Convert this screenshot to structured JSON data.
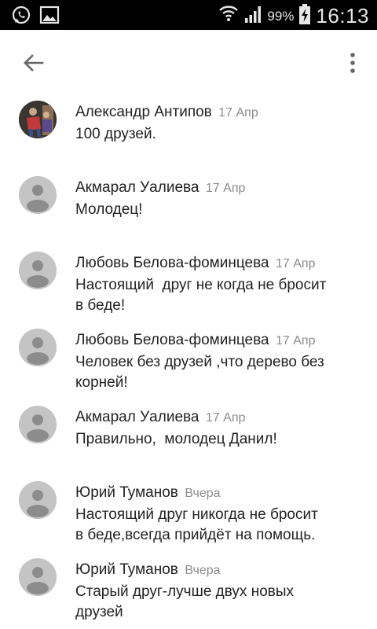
{
  "status_bar": {
    "left_icons": [
      "whatsapp-icon",
      "image-icon"
    ],
    "right_icons": [
      "wifi-icon",
      "signal-icon",
      "battery-charging-icon"
    ],
    "battery": "99%",
    "time": "16:13"
  },
  "app_bar": {
    "back_icon": "arrow-back-icon",
    "menu_icon": "more-vert-icon"
  },
  "comments": [
    {
      "author": "Александр Антипов",
      "date": "17 Апр",
      "text": "100 друзей.",
      "avatar": "photo"
    },
    {
      "author": "Акмарал Уалиева",
      "date": "17 Апр",
      "text": "Молодец!",
      "avatar": "default"
    },
    {
      "author": "Любовь Белова-фоминцева",
      "date": "17 Апр",
      "text": "Настоящий  друг не когда не бросит\nв беде!",
      "avatar": "default"
    },
    {
      "author": "Любовь Белова-фоминцева",
      "date": "17 Апр",
      "text": "Человек без друзей ,что дерево без\nкорней!",
      "avatar": "default"
    },
    {
      "author": "Акмарал Уалиева",
      "date": "17 Апр",
      "text": "Правильно,  молодец Данил!",
      "avatar": "default"
    },
    {
      "author": "Юрий Туманов",
      "date": "Вчера",
      "text": "Настоящий друг никогда не бросит\nв беде,всегда прийдёт на помощь.",
      "avatar": "default"
    },
    {
      "author": "Юрий Туманов",
      "date": "Вчера",
      "text": "Старый друг-лучше двух новых\nдрузей",
      "avatar": "default"
    }
  ]
}
